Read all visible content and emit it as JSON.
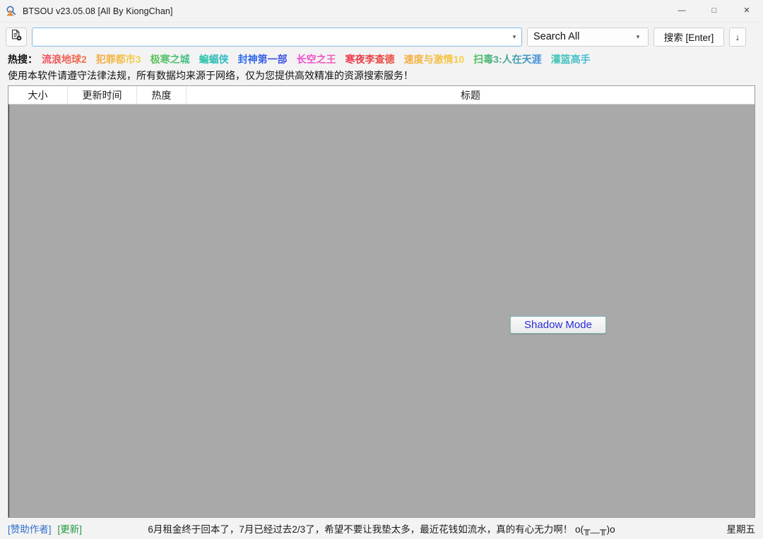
{
  "window": {
    "title": "BTSOU v23.05.08 [All By KiongChan]",
    "app_icon": "magnifier-person-icon",
    "controls": {
      "minimize": "—",
      "maximize": "□",
      "close": "✕"
    }
  },
  "toolbar": {
    "settings_icon": "document-gear-icon",
    "search_input": {
      "value": "",
      "placeholder": ""
    },
    "combo_arrow": "chevron-down-icon",
    "scope": {
      "selected": "Search All",
      "options": [
        "Search All"
      ]
    },
    "search_button": "搜索 [Enter]",
    "download_button": "↓"
  },
  "hot_search": {
    "label": "热搜：",
    "tags": [
      {
        "text": "流浪地球2",
        "color_from": "#f2455a",
        "color_to": "#f0734a"
      },
      {
        "text": "犯罪都市3",
        "color_from": "#f5a33a",
        "color_to": "#f0d24a"
      },
      {
        "text": "极寒之城",
        "color_from": "#5fc253",
        "color_to": "#3fc08a"
      },
      {
        "text": "蝙蝠侠",
        "color_from": "#2ec4a6",
        "color_to": "#2fb8c9"
      },
      {
        "text": "封神第一部",
        "color_from": "#2a6ef0",
        "color_to": "#3f4fe0"
      },
      {
        "text": "长空之王",
        "color_from": "#ef4bd2",
        "color_to": "#f05bb6"
      },
      {
        "text": "寒夜李查德",
        "color_from": "#f0324a",
        "color_to": "#e8503f"
      },
      {
        "text": "速度与激情10",
        "color_from": "#f5a83a",
        "color_to": "#f5cf46"
      },
      {
        "text": "扫毒3:人在天涯",
        "color_from": "#4ec258",
        "color_to": "#3a8ae0"
      },
      {
        "text": "灌篮高手",
        "color_from": "#3fc7b0",
        "color_to": "#46b8d8"
      }
    ]
  },
  "notice": "使用本软件请遵守法律法规，所有数据均来源于网络，仅为您提供高效精准的资源搜索服务！",
  "results_table": {
    "columns": [
      "大小",
      "更新时间",
      "热度",
      "标题"
    ],
    "rows": [],
    "empty_background": "#a9a9a9"
  },
  "overlay": {
    "shadow_mode_button": "Shadow Mode",
    "button_text_color": "#2b2bd8",
    "button_border_color": "#7fbfbf"
  },
  "statusbar": {
    "sponsor_link": "[赞助作者]",
    "update_link": "[更新]",
    "message": "6月租金终于回本了，7月已经过去2/3了，希望不要让我垫太多，最近花钱如流水，真的有心无力啊！ o(╥﹏╥)o",
    "weekday": "星期五",
    "sponsor_color": "#2f6fd0",
    "update_color": "#1f9a3f"
  }
}
